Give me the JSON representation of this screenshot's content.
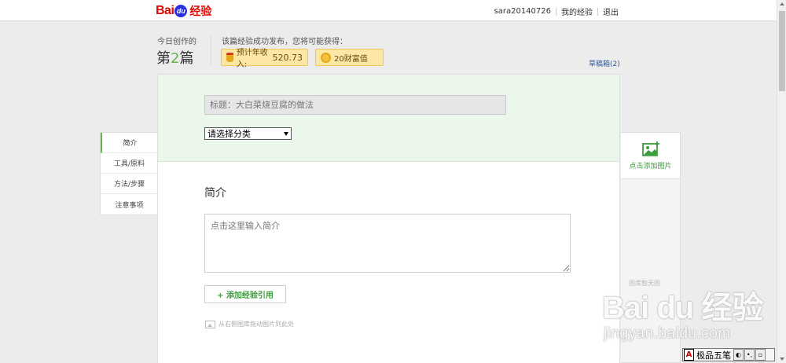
{
  "header": {
    "logo_bai": "Bai",
    "logo_du": "du",
    "logo_jingyan": "经验",
    "username": "sara20140726",
    "my_experience": "我的经验",
    "logout": "退出"
  },
  "summary": {
    "today_label": "今日创作的",
    "count_prefix": "第",
    "count_number": "2",
    "count_suffix": "篇",
    "publish_note": "该篇经验成功发布，您将可能获得：",
    "income_label": "预计年收入:",
    "income_value": "520.73",
    "wealth_label": "20财富值",
    "drafts": "草稿箱(2)"
  },
  "editor": {
    "title_placeholder": "标题：大白菜烧豆腐的做法",
    "category_selected": "请选择分类",
    "section_title": "简介",
    "intro_placeholder": "点击这里输入简介",
    "add_reference": "+ 添加经验引用",
    "drag_hint": "从右侧图库拖动图片到此处"
  },
  "sidenav": {
    "items": [
      {
        "label": "简介"
      },
      {
        "label": "工具/原料"
      },
      {
        "label": "方法/步骤"
      },
      {
        "label": "注意事项"
      }
    ]
  },
  "image_panel": {
    "add_image": "点击添加图片",
    "empty_text": "图库暂无图"
  },
  "watermark": {
    "logo": "Bai du 经验",
    "url": "jingyan.baidu.com"
  },
  "ime": {
    "mode": "A",
    "name": "极品五笔"
  },
  "colors": {
    "accent_green": "#6bb04f",
    "logo_red": "#e10601",
    "logo_blue": "#2932e1"
  }
}
